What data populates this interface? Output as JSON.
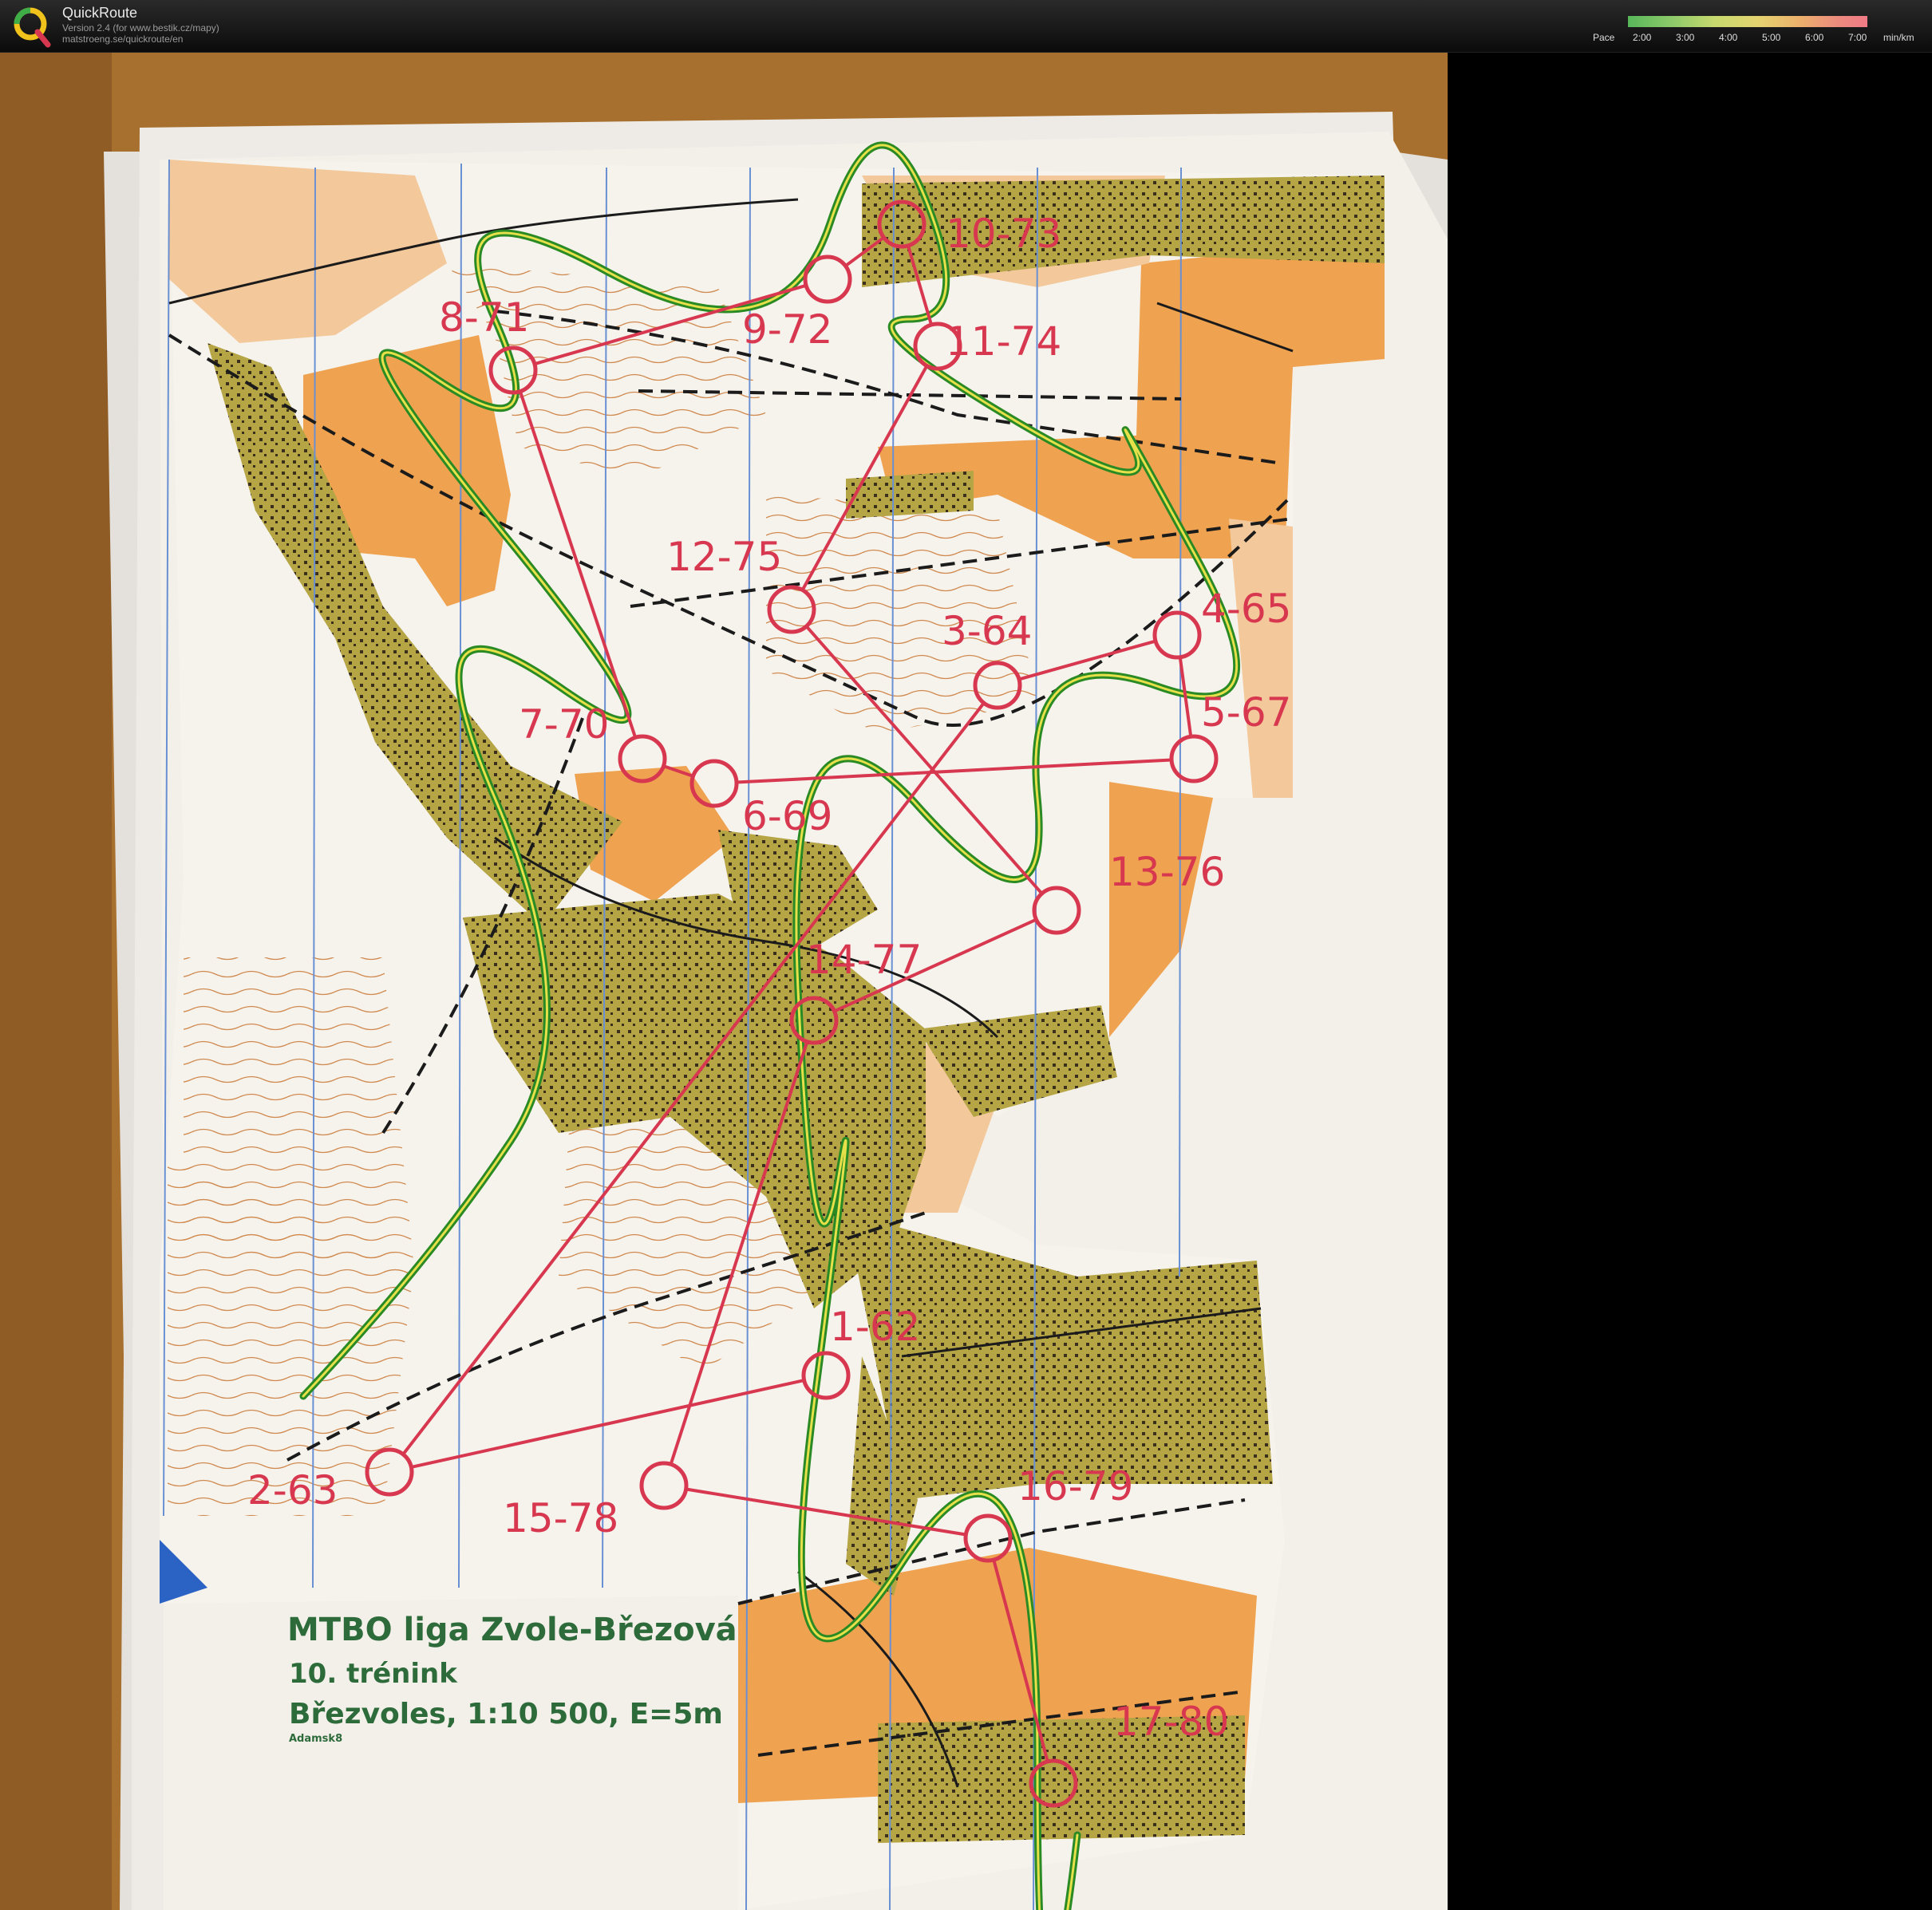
{
  "header": {
    "app_name": "QuickRoute",
    "version": "Version 2.4  (for www.bestik.cz/mapy)",
    "url": "matstroeng.se/quickroute/en",
    "pace_label": "Pace",
    "pace_ticks": [
      "2:00",
      "3:00",
      "4:00",
      "5:00",
      "6:00",
      "7:00"
    ],
    "pace_unit": "min/km"
  },
  "map": {
    "title_line1": "MTBO liga Zvole-Březová",
    "title_line2": "10. trénink",
    "title_line3": "Březvoles, 1:10 500, E=5m",
    "author": "Adamsk8",
    "controls": [
      {
        "label": "1-62"
      },
      {
        "label": "2-63"
      },
      {
        "label": "3-64"
      },
      {
        "label": "4-65"
      },
      {
        "label": "5-67"
      },
      {
        "label": "6-69"
      },
      {
        "label": "7-70"
      },
      {
        "label": "8-71"
      },
      {
        "label": "9-72"
      },
      {
        "label": "10-73"
      },
      {
        "label": "11-74"
      },
      {
        "label": "12-75"
      },
      {
        "label": "13-76"
      },
      {
        "label": "14-77"
      },
      {
        "label": "15-78"
      },
      {
        "label": "16-79"
      },
      {
        "label": "17-80"
      }
    ],
    "colors": {
      "course": "#d8384f",
      "route": "#2a8a24",
      "open_land": "#efa24f",
      "forest_built": "#b5a545",
      "paper": "#f3f0ea",
      "table": "#b07a3a",
      "water": "#2a63c4"
    }
  }
}
